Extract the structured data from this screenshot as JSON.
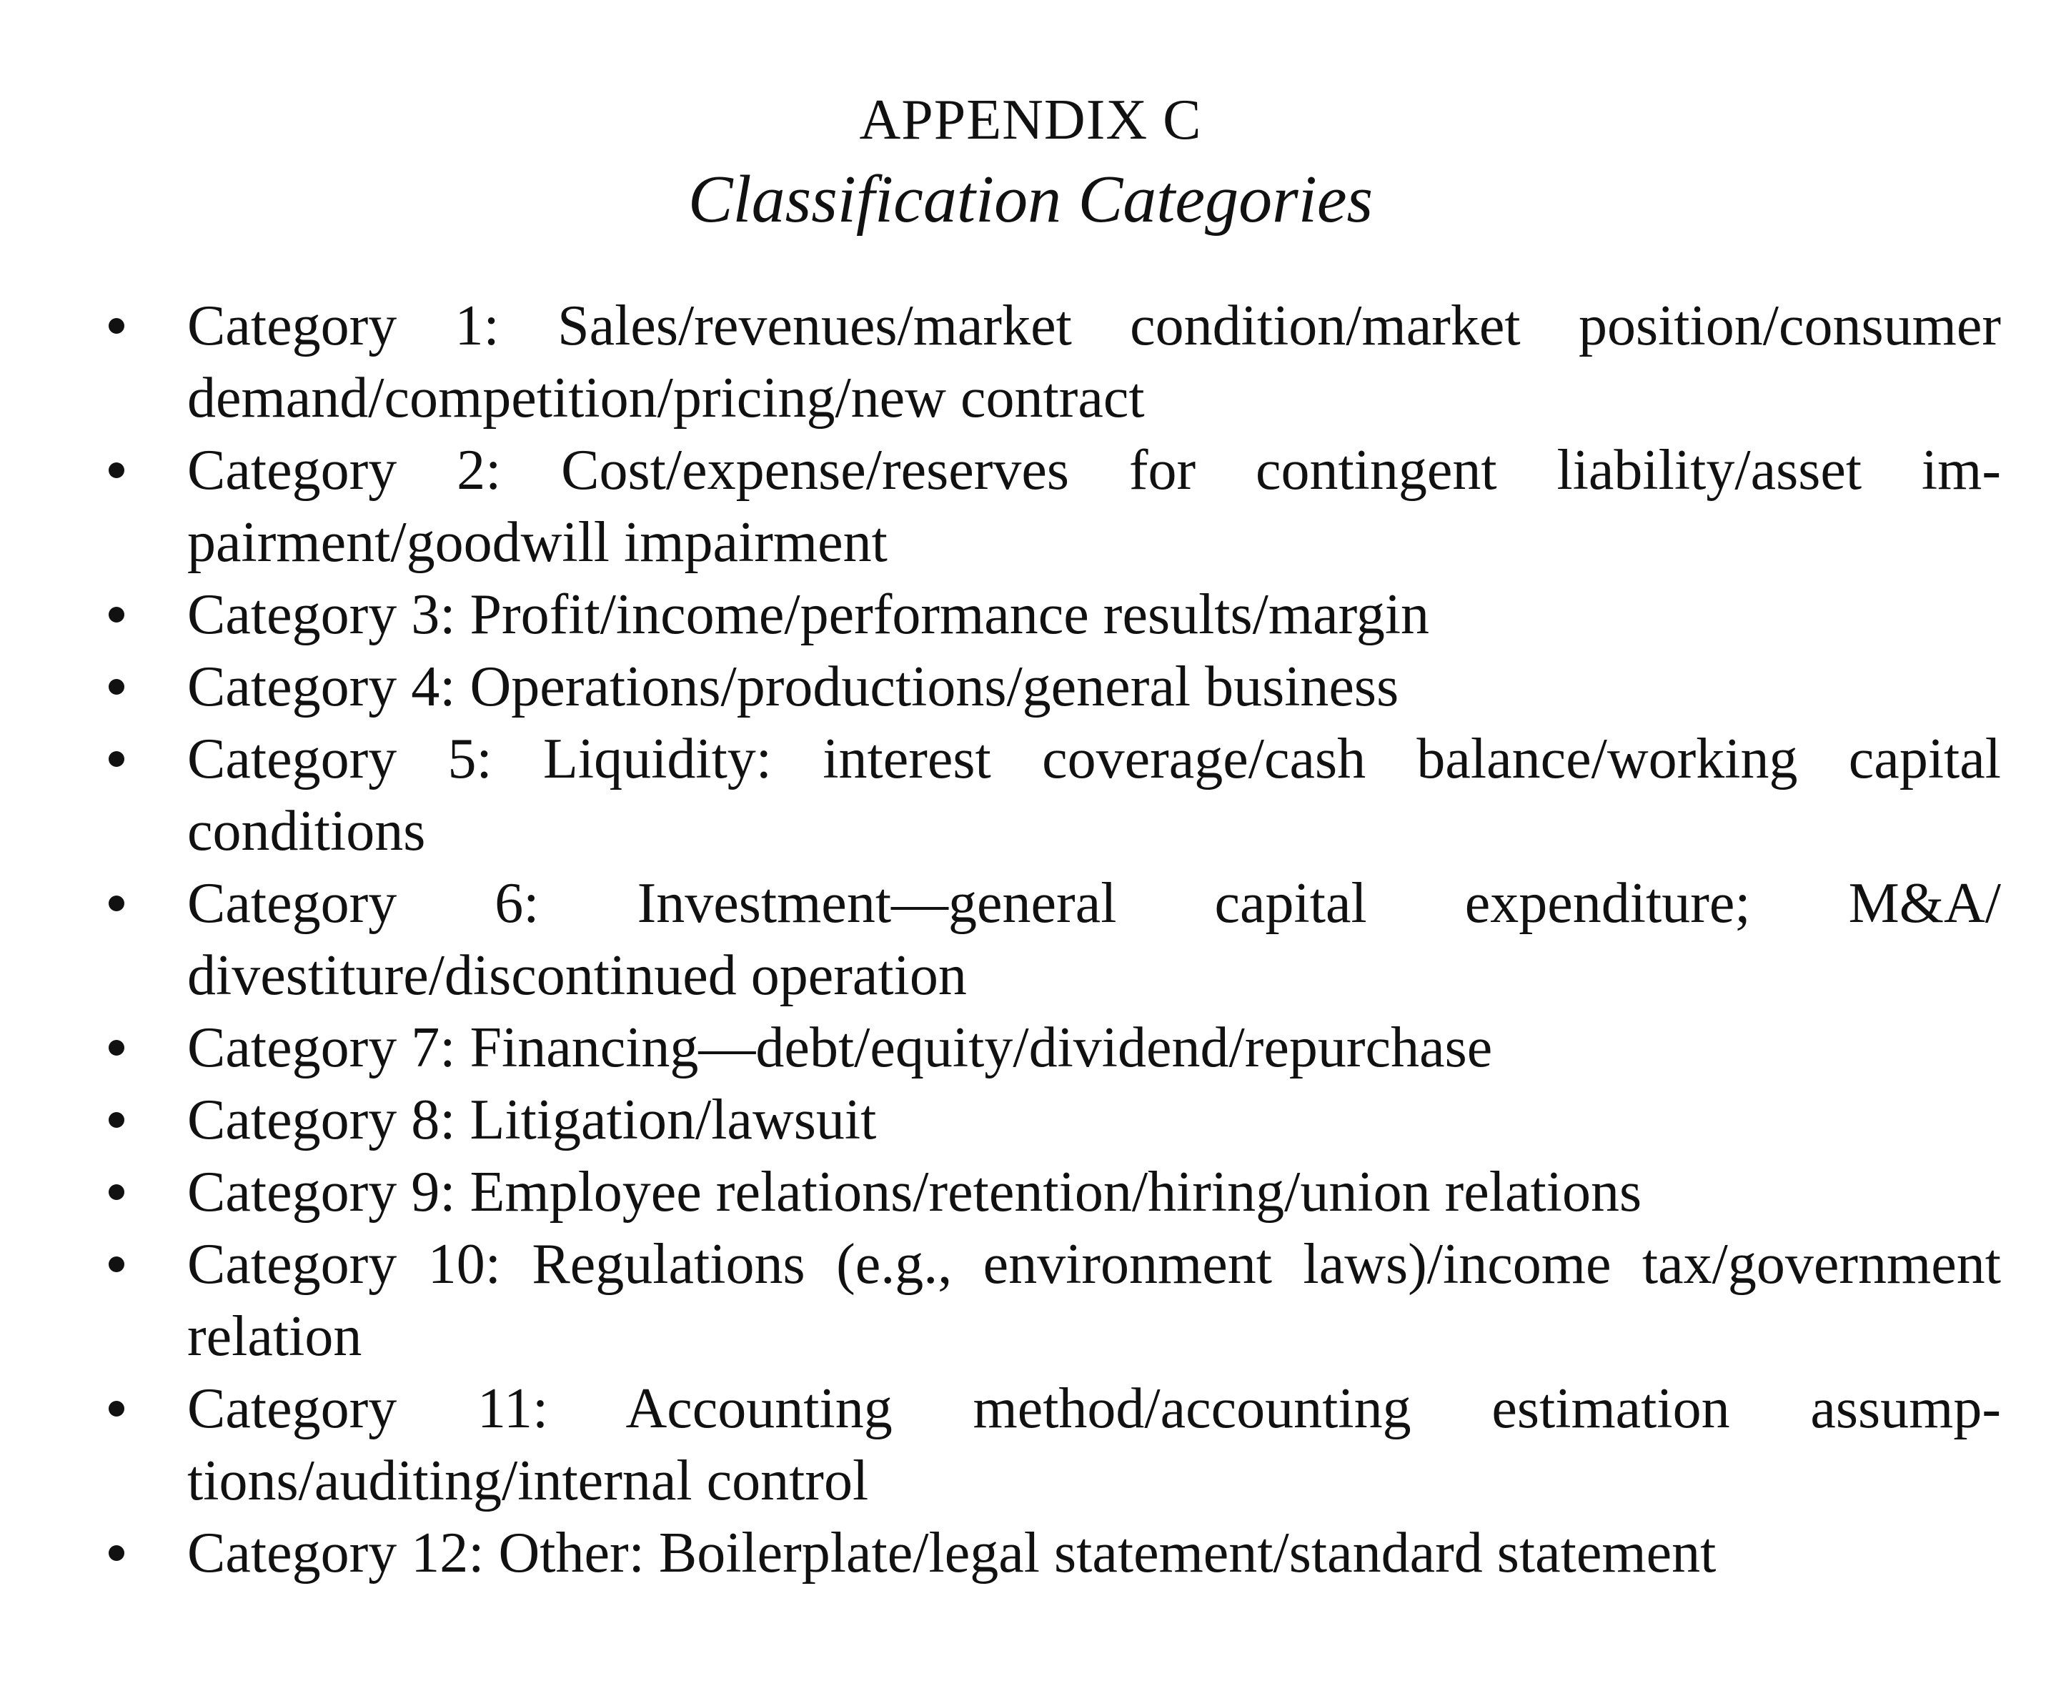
{
  "appendix": {
    "label": "APPENDIX C",
    "title": "Classification Categories"
  },
  "categories": [
    {
      "text": "Category 1: Sales/revenues/market condition/market position/​consumer demand/competition/pricing/new contract"
    },
    {
      "text": "Category 2: Cost/expense/reserves for contingent liability/asset im­pairment/goodwill impairment"
    },
    {
      "text": "Category 3: Profit/income/performance results/margin"
    },
    {
      "text": "Category 4: Operations/productions/general business"
    },
    {
      "text": "Category 5: Liquidity: interest coverage/cash balance/working capital conditions"
    },
    {
      "text": "Category 6: Investment—general capital expenditure; M&A/​divestiture/discontinued operation"
    },
    {
      "text": "Category 7: Financing—debt/equity/dividend/repurchase"
    },
    {
      "text": "Category 8: Litigation/lawsuit"
    },
    {
      "text": "Category 9: Employee relations/retention/hiring/union relations"
    },
    {
      "text": "Category 10: Regulations (e.g., environment laws)/income tax/​government relation"
    },
    {
      "text": "Category 11: Accounting method/accounting estimation assump­tions/auditing/internal control"
    },
    {
      "text": "Category 12: Other: Boilerplate/legal statement/standard statement"
    }
  ]
}
